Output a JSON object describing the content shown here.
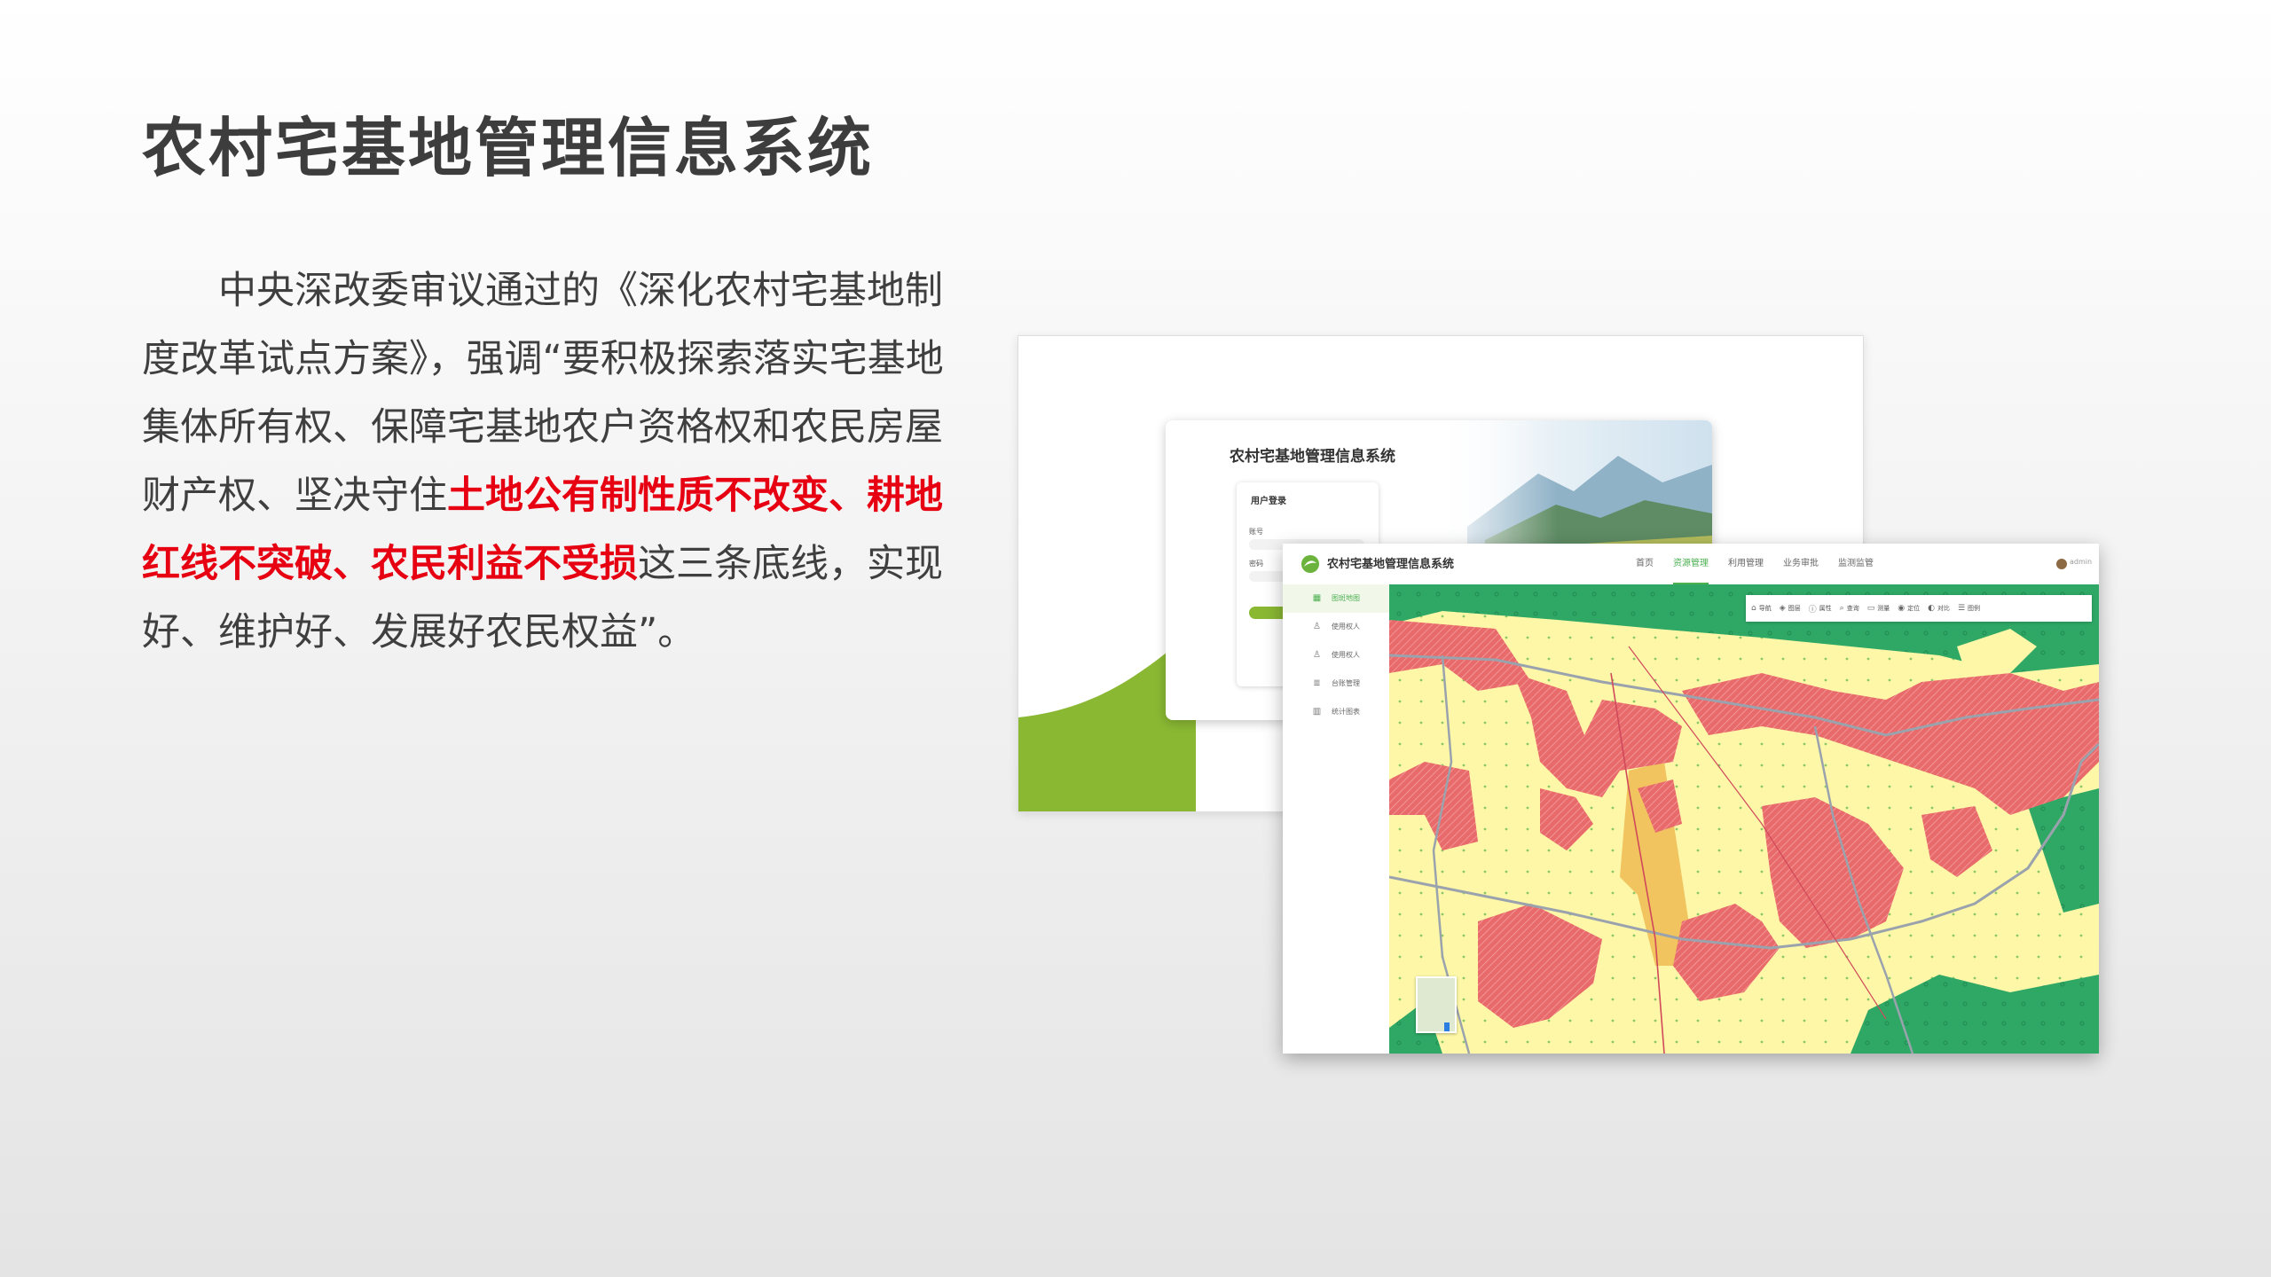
{
  "slide": {
    "title": "农村宅基地管理信息系统",
    "paragraph": {
      "before": "中央深改委审议通过的《深化农村宅基地制度改革试点方案》，强调“要积极探索落实宅基地集体所有权、保障宅基地农户资格权和农民房屋财产权、坚决守住",
      "highlight": "土地公有制性质不改变、耕地红线不突破、农民利益不受损",
      "after": "这三条底线，实现好、维护好、发展好农民权益”。"
    },
    "highlight_color": "#e60012"
  },
  "login_screenshot": {
    "title": "农村宅基地管理信息系统",
    "form_title": "用户登录",
    "username_label": "账号",
    "password_label": "密码",
    "accent_color": "#8ab833"
  },
  "app_screenshot": {
    "title": "农村宅基地管理信息系统",
    "nav": [
      "首页",
      "资源管理",
      "利用管理",
      "业务审批",
      "监测监管"
    ],
    "active_nav": "资源管理",
    "user_name": "admin",
    "sidebar": [
      {
        "label": "图斑地图",
        "icon": "map-icon"
      },
      {
        "label": "使用权人",
        "icon": "user-icon"
      },
      {
        "label": "使用权人",
        "icon": "user-icon"
      },
      {
        "label": "台账管理",
        "icon": "database-icon"
      },
      {
        "label": "统计图表",
        "icon": "chart-icon"
      }
    ],
    "toolbar": [
      "导航",
      "图层",
      "属性",
      "查询",
      "测量",
      "定位",
      "对比",
      "图例"
    ],
    "map_legend_colors": {
      "homestead": "#e96a6a",
      "farmland": "#fdf7a7",
      "forest": "#2fa866",
      "construction": "#f1c45f",
      "road": "#9aa3ad"
    }
  }
}
